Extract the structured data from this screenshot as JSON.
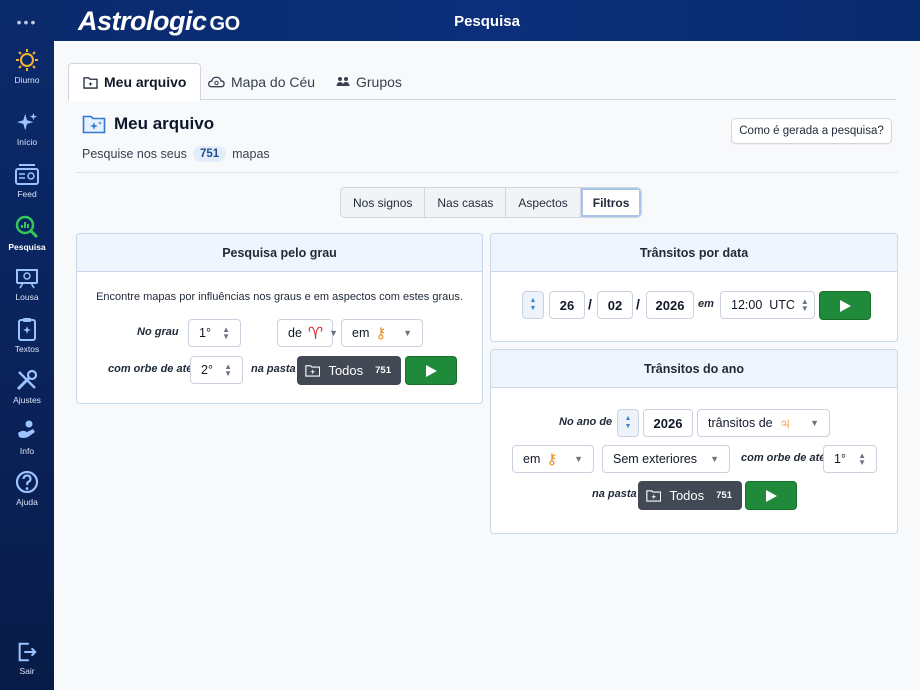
{
  "app": {
    "logo_main": "Astrologic",
    "logo_suffix": "GO",
    "page_title": "Pesquisa"
  },
  "sidebar": {
    "dots": "•••",
    "items": [
      {
        "label": "Diurno"
      },
      {
        "label": "Início"
      },
      {
        "label": "Feed"
      },
      {
        "label": "Pesquisa"
      },
      {
        "label": "Lousa"
      },
      {
        "label": "Textos"
      },
      {
        "label": "Ajustes"
      },
      {
        "label": "Info"
      },
      {
        "label": "Ajuda"
      },
      {
        "label": "Sair"
      }
    ]
  },
  "tabs": [
    {
      "label": "Meu arquivo",
      "active": true
    },
    {
      "label": "Mapa do Céu"
    },
    {
      "label": "Grupos"
    }
  ],
  "header": {
    "title": "Meu arquivo",
    "sub_prefix": "Pesquise nos seus",
    "count": "751",
    "sub_suffix": "mapas",
    "how_button": "Como é gerada a pesquisa?"
  },
  "segments": [
    "Nos signos",
    "Nas casas",
    "Aspectos",
    "Filtros"
  ],
  "degree_search": {
    "title": "Pesquisa pelo grau",
    "description": "Encontre mapas por influências nos graus e em aspectos com estes graus.",
    "label_grau": "No grau",
    "grau_value": "1°",
    "de_label": "de",
    "de_glyph": "♈",
    "em_label": "em",
    "em_glyph": "⚷",
    "orb_label": "com orbe de até",
    "orb_value": "2°",
    "folder_label": "na pasta",
    "folder_button": "Todos",
    "folder_count": "751"
  },
  "date_transits": {
    "title": "Trânsitos por data",
    "day": "26",
    "month": "02",
    "year": "2026",
    "sep": "/",
    "em_label": "em",
    "time": "12:00  UTC"
  },
  "year_transits": {
    "title": "Trânsitos do ano",
    "year_label": "No ano de",
    "year": "2026",
    "transits_label": "trânsitos de",
    "transits_glyph": "♃",
    "em_label": "em",
    "em_glyph": "⚷",
    "exterior": "Sem exteriores",
    "orb_label": "com orbe de até",
    "orb_value": "1°",
    "folder_label": "na pasta",
    "folder_button": "Todos",
    "folder_count": "751"
  },
  "colors": {
    "accent": "#0b2a6b",
    "go": "#1f8a3a",
    "red_glyph": "#e0292f",
    "orange_glyph": "#f08a24"
  }
}
